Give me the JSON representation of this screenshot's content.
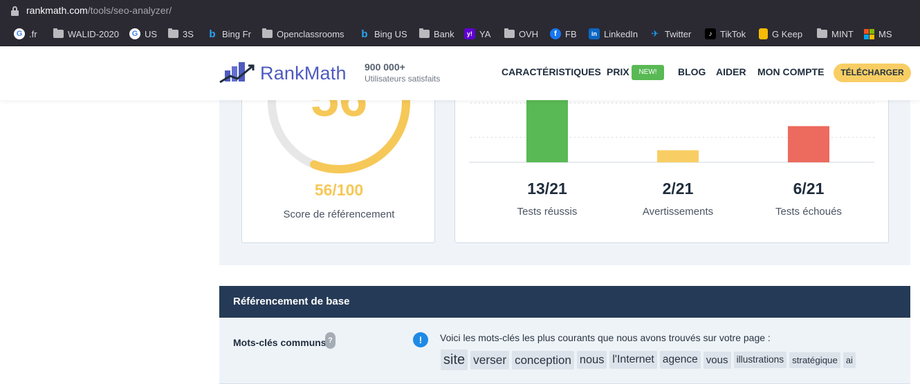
{
  "browser": {
    "url_domain": "rankmath.com",
    "url_path": "/tools/seo-analyzer/",
    "bookmarks": [
      {
        "label": ".fr",
        "icon": "google-icon"
      },
      {
        "label": "WALID-2020",
        "icon": "folder-icon"
      },
      {
        "label": "US",
        "icon": "google-icon"
      },
      {
        "label": "3S",
        "icon": "folder-icon"
      },
      {
        "label": "Bing Fr",
        "icon": "bing-icon"
      },
      {
        "label": "Openclassrooms",
        "icon": "folder-icon"
      },
      {
        "label": "Bing US",
        "icon": "bing-icon"
      },
      {
        "label": "Bank",
        "icon": "folder-icon"
      },
      {
        "label": "YA",
        "icon": "yahoo-icon"
      },
      {
        "label": "OVH",
        "icon": "folder-icon"
      },
      {
        "label": "FB",
        "icon": "facebook-icon"
      },
      {
        "label": "LinkedIn",
        "icon": "linkedin-icon"
      },
      {
        "label": "Twitter",
        "icon": "twitter-icon"
      },
      {
        "label": "TikTok",
        "icon": "tiktok-icon"
      },
      {
        "label": "G Keep",
        "icon": "keep-icon"
      },
      {
        "label": "MINT",
        "icon": "folder-icon"
      },
      {
        "label": "MS",
        "icon": "microsoft-icon"
      }
    ]
  },
  "header": {
    "brand": "RankMath",
    "users_count": "900 000+",
    "users_label": "Utilisateurs satisfaits",
    "nav": {
      "features": "CARACTÉRISTIQUES",
      "pricing": "PRIX",
      "new_badge": "NEW!",
      "blog": "BLOG",
      "help": "AIDER",
      "account": "MON COMPTE"
    },
    "download_label": "TÉLÉCHARGER"
  },
  "score": {
    "value_text": "56/100",
    "label": "Score de référencement",
    "fraction": 0.56
  },
  "colors": {
    "passed": "#59b954",
    "warning": "#f8ce64",
    "failed": "#ec6a5e",
    "header_dark": "#253a56",
    "brand": "#4e5bbf"
  },
  "chart_data": {
    "type": "bar",
    "categories": [
      "Tests réussis",
      "Avertissements",
      "Tests échoués"
    ],
    "values": [
      13,
      2,
      6
    ],
    "total": 21,
    "value_labels": [
      "13/21",
      "2/21",
      "6/21"
    ],
    "grid": true
  },
  "basic_seo": {
    "title": "Référencement de base",
    "keywords_label": "Mots-clés communs",
    "help_glyph": "?",
    "info_glyph": "!",
    "keywords_description": "Voici les mots-clés les plus courants que nous avons trouvés sur votre page :",
    "keywords": [
      {
        "word": "site",
        "weight": 1.0
      },
      {
        "word": "verser",
        "weight": 0.7
      },
      {
        "word": "conception",
        "weight": 0.65
      },
      {
        "word": "nous",
        "weight": 0.6
      },
      {
        "word": "l'Internet",
        "weight": 0.55
      },
      {
        "word": "agence",
        "weight": 0.5
      },
      {
        "word": "vous",
        "weight": 0.45
      },
      {
        "word": "illustrations",
        "weight": 0.3
      },
      {
        "word": "stratégique",
        "weight": 0.25
      },
      {
        "word": "ai",
        "weight": 0.2
      }
    ]
  }
}
